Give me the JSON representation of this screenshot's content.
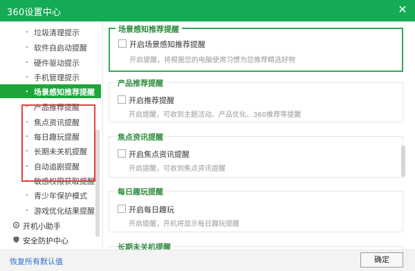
{
  "window": {
    "title": "360设置中心",
    "close_glyph": "✕"
  },
  "sidebar": {
    "items": [
      {
        "label": "垃圾清理提示"
      },
      {
        "label": "软件自启动提醒"
      },
      {
        "label": "硬件驱动提示"
      },
      {
        "label": "手机管理提示"
      },
      {
        "label": "场景感知推荐提醒",
        "active": true
      },
      {
        "label": "产品推荐提醒"
      },
      {
        "label": "焦点资讯提醒"
      },
      {
        "label": "每日趣玩提醒"
      },
      {
        "label": "长期未关机提醒"
      },
      {
        "label": "自动追剧提醒"
      },
      {
        "label": "敏感权限获取提醒"
      },
      {
        "label": "青少年保护模式"
      },
      {
        "label": "游戏优化结果提醒"
      }
    ],
    "categories": [
      {
        "label": "开机小助手",
        "icon": "gear-icon"
      },
      {
        "label": "安全防护中心",
        "icon": "shield-icon"
      }
    ]
  },
  "sections": [
    {
      "title": "场景感知推荐提醒",
      "checkbox": "开启场景感知推荐提醒",
      "desc": "开启提醒，将根据您的电脑使用习惯为您推荐精选好物"
    },
    {
      "title": "产品推荐提醒",
      "checkbox": "开启推荐提醒",
      "desc": "开启提醒，可收到主题活动、产品优化、360推荐等提醒"
    },
    {
      "title": "焦点资讯提醒",
      "checkbox": "开启焦点资讯提醒",
      "desc": "开启提醒，可收到焦点资讯提醒"
    },
    {
      "title": "每日趣玩提醒",
      "checkbox": "开启每日趣玩",
      "desc": "开启提醒，开机将显示每日趣玩提醒"
    },
    {
      "title": "长期未关机提醒"
    }
  ],
  "footer": {
    "restore": "恢复所有默认值",
    "ok": "确定"
  },
  "colors": {
    "titlebar": "#14ab55",
    "active": "#1da53a",
    "highlight_border": "#2fa84f",
    "annotation": "#e83b3b"
  }
}
